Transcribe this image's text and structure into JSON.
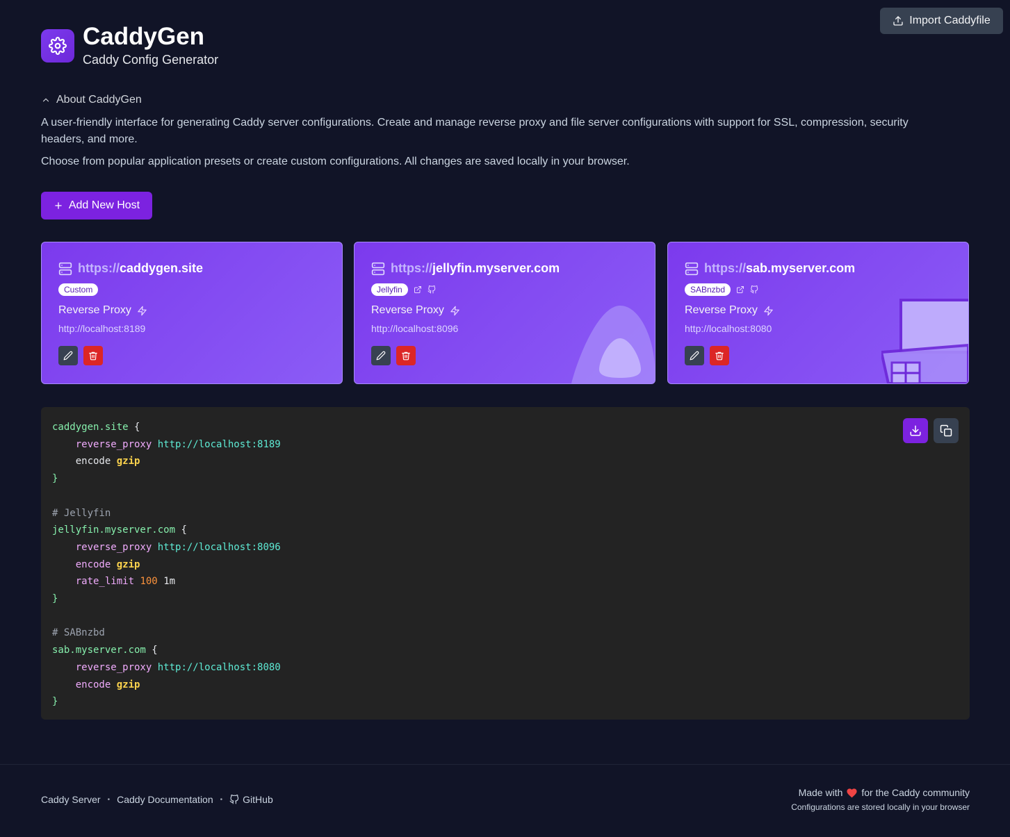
{
  "colors": {
    "background": "#111427",
    "accent": "#7c22e0",
    "card": "#7c3aed",
    "delete": "#dc2626"
  },
  "header": {
    "title": "CaddyGen",
    "subtitle": "Caddy Config Generator",
    "logo_icon": "gear-icon",
    "import_label": "Import Caddyfile"
  },
  "about": {
    "toggle_label": "About CaddyGen",
    "paragraph1": "A user-friendly interface for generating Caddy server configurations. Create and manage reverse proxy and file server configurations with support for SSL, compression, security headers, and more.",
    "paragraph2": "Choose from popular application presets or create custom configurations. All changes are saved locally in your browser."
  },
  "add_host_label": "Add New Host",
  "hosts": [
    {
      "scheme": "https://",
      "domain": "caddygen.site",
      "badge": "Custom",
      "type": "Reverse Proxy",
      "upstream": "http://localhost:8189"
    },
    {
      "scheme": "https://",
      "domain": "jellyfin.myserver.com",
      "badge": "Jellyfin",
      "type": "Reverse Proxy",
      "upstream": "http://localhost:8096"
    },
    {
      "scheme": "https://",
      "domain": "sab.myserver.com",
      "badge": "SABnzbd",
      "type": "Reverse Proxy",
      "upstream": "http://localhost:8080"
    }
  ],
  "code": {
    "block1": {
      "domain": "caddygen.site",
      "brace_open": "{",
      "rp": "reverse_proxy",
      "url": "http://localhost:8189",
      "enc": "encode",
      "gzip": "gzip",
      "brace_close": "}"
    },
    "block2": {
      "comment": "# Jellyfin",
      "domain": "jellyfin.myserver.com",
      "brace_open": "{",
      "rp": "reverse_proxy",
      "url": "http://localhost:8096",
      "enc": "encode",
      "gzip": "gzip",
      "rate": "rate_limit",
      "rate_num": "100",
      "rate_unit": "1m",
      "brace_close": "}"
    },
    "block3": {
      "comment": "# SABnzbd",
      "domain": "sab.myserver.com",
      "brace_open": "{",
      "rp": "reverse_proxy",
      "url": "http://localhost:8080",
      "enc": "encode",
      "gzip": "gzip",
      "brace_close": "}"
    }
  },
  "footer": {
    "link1": "Caddy Server",
    "link2": "Caddy Documentation",
    "link3": "GitHub",
    "made_prefix": "Made with",
    "made_suffix": "for the Caddy community",
    "stored": "Configurations are stored locally in your browser"
  }
}
